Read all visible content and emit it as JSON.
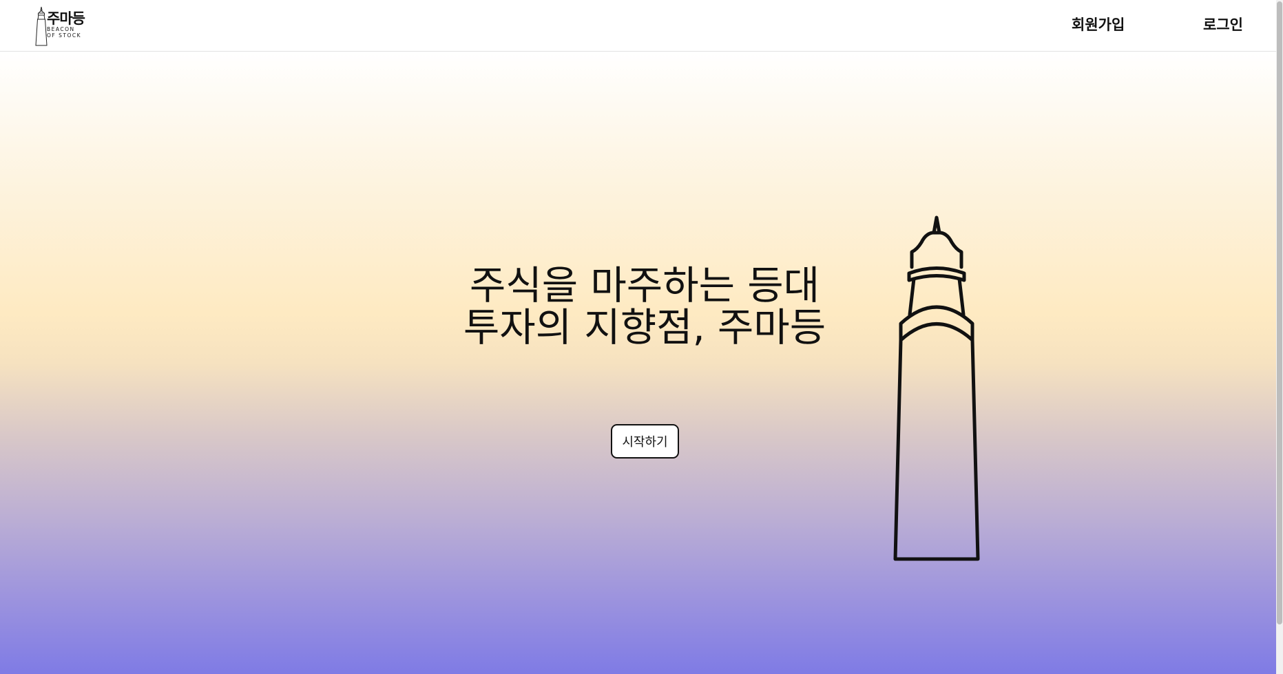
{
  "header": {
    "logo": {
      "title": "주마등",
      "subtitle_line1": "BEACON",
      "subtitle_line2": "OF STOCK"
    },
    "nav": {
      "signup_label": "회원가입",
      "login_label": "로그인"
    }
  },
  "hero": {
    "headline_line1": "주식을 마주하는 등대",
    "headline_line2": "투자의 지향점, 주마등",
    "start_button_label": "시작하기",
    "illustration": "lighthouse-icon"
  },
  "colors": {
    "gradient_top": "#ffffff",
    "gradient_middle": "#feeac2",
    "gradient_bottom": "#7f7be5",
    "text": "#111111"
  }
}
